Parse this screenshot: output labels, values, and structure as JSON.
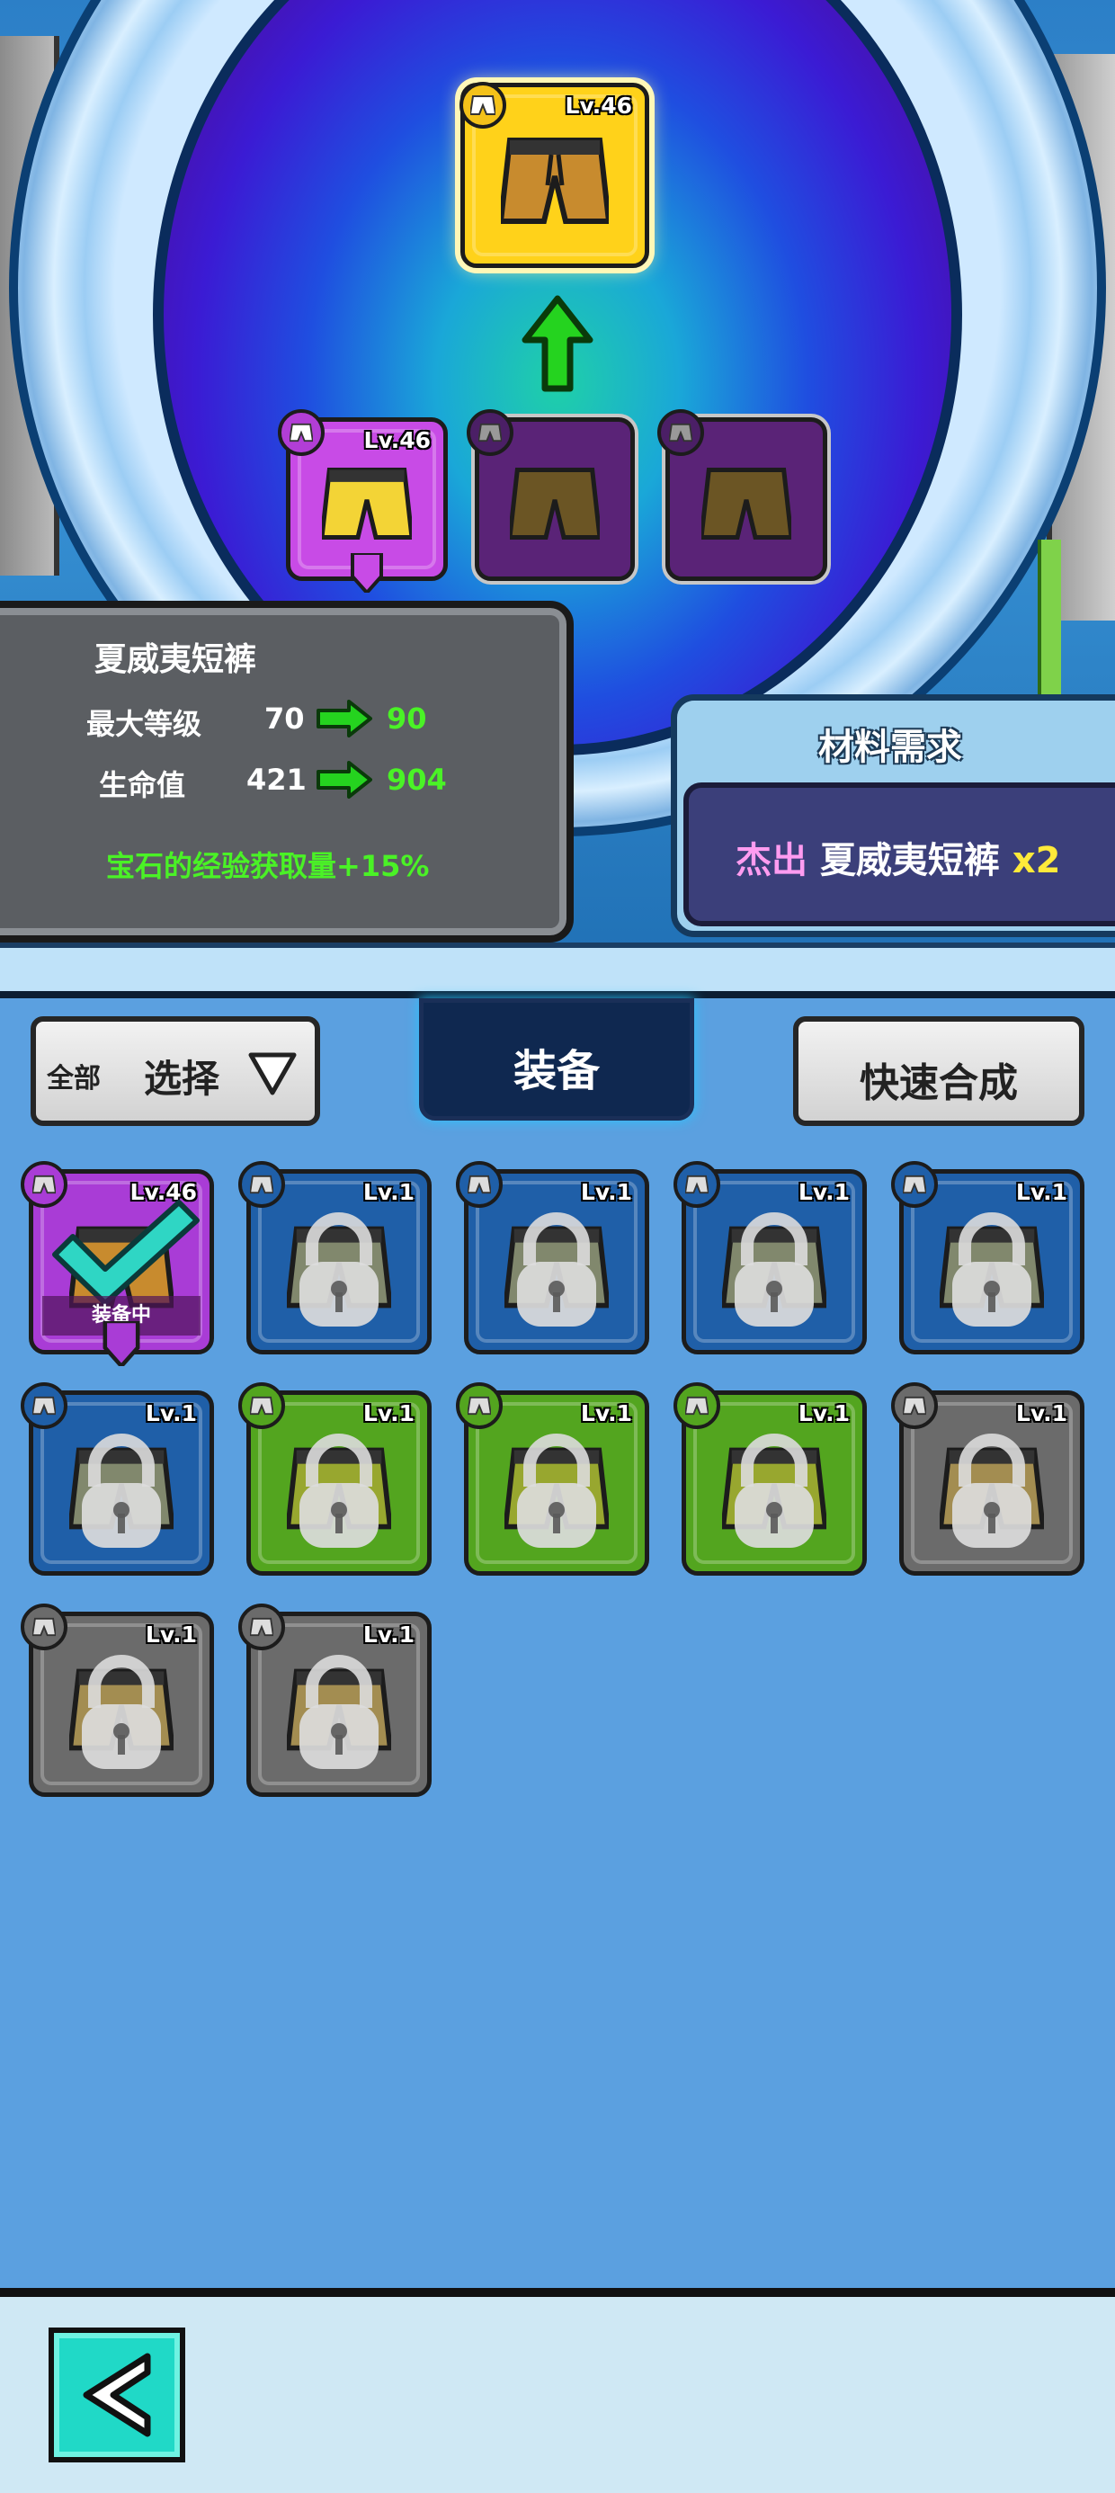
{
  "result_item": {
    "level": "Lv.46",
    "frame_color": "#ffd21a",
    "icon": "shorts-icon"
  },
  "upgrade_arrow": {
    "color": "#25d31f",
    "icon": "up-arrow-icon"
  },
  "material_slots": [
    {
      "level": "Lv.46",
      "frame_color": "#c84be6",
      "filled": true
    },
    {
      "level": "",
      "frame_color": "#5a2377",
      "filled": false
    },
    {
      "level": "",
      "frame_color": "#5a2377",
      "filled": false
    }
  ],
  "stats": {
    "item_name": "夏威夷短裤",
    "max_level": {
      "label": "最大等级",
      "old": "70",
      "new": "90"
    },
    "hp": {
      "label": "生命值",
      "old": "421",
      "new": "904"
    },
    "bonus": "宝石的经验获取量+15%"
  },
  "materials": {
    "title": "材料需求",
    "rarity": "杰出",
    "name": "夏威夷短裤",
    "count": "x2"
  },
  "toolbar": {
    "filter_all": "全部",
    "select_label": "选择",
    "tab_label": "装备",
    "quick_merge_label": "快速合成"
  },
  "inventory": [
    {
      "level": "Lv.46",
      "color": "#a93cd6",
      "equipped": true,
      "equipped_label": "装备中",
      "locked": false
    },
    {
      "level": "Lv.1",
      "color": "#1f5fa8",
      "locked": true
    },
    {
      "level": "Lv.1",
      "color": "#1f5fa8",
      "locked": true
    },
    {
      "level": "Lv.1",
      "color": "#1f5fa8",
      "locked": true
    },
    {
      "level": "Lv.1",
      "color": "#1f5fa8",
      "locked": true
    },
    {
      "level": "Lv.1",
      "color": "#1f5fa8",
      "locked": true
    },
    {
      "level": "Lv.1",
      "color": "#53a51f",
      "locked": true
    },
    {
      "level": "Lv.1",
      "color": "#53a51f",
      "locked": true
    },
    {
      "level": "Lv.1",
      "color": "#53a51f",
      "locked": true
    },
    {
      "level": "Lv.1",
      "color": "#6b6b6b",
      "locked": true
    },
    {
      "level": "Lv.1",
      "color": "#6b6b6b",
      "locked": true
    },
    {
      "level": "Lv.1",
      "color": "#6b6b6b",
      "locked": true
    }
  ],
  "back_button": {
    "icon": "back-arrow-icon",
    "color": "#20d9c7"
  }
}
